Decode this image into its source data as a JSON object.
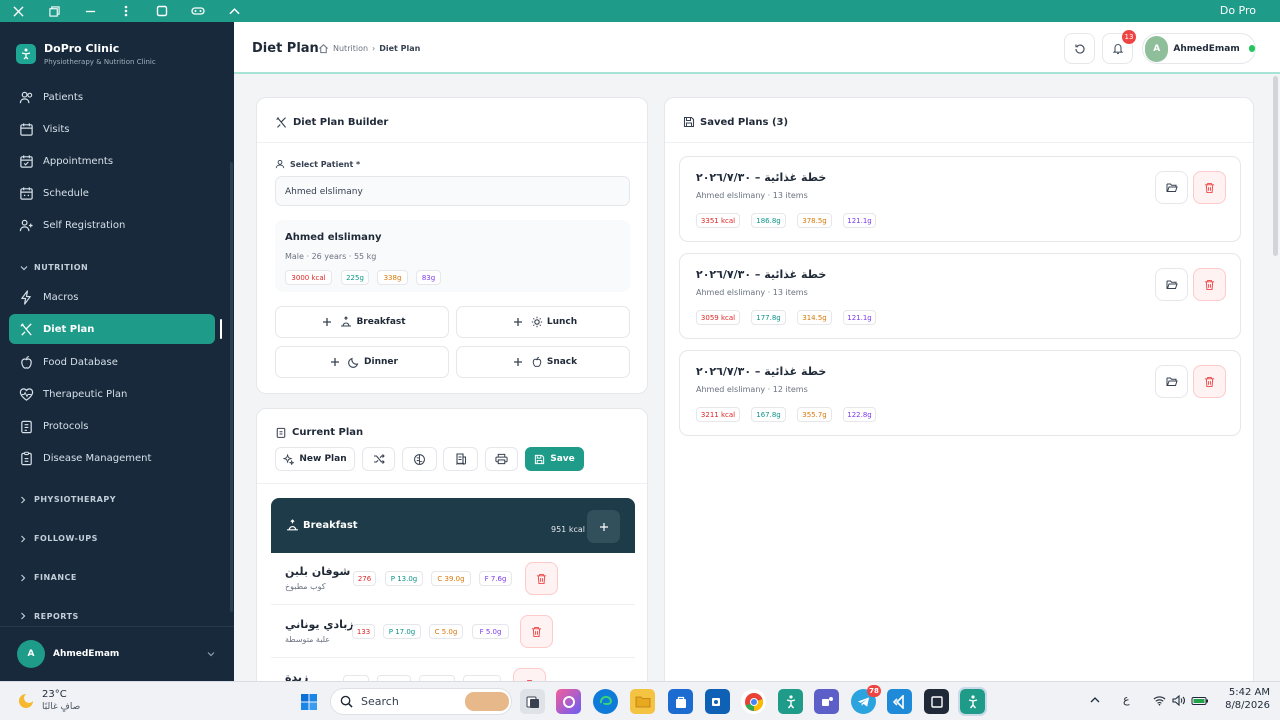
{
  "window": {
    "title": "Do Pro"
  },
  "sidebar": {
    "brand_name": "DoPro Clinic",
    "brand_sub": "Physiotherapy & Nutrition Clinic",
    "items": [
      {
        "label": "Patients"
      },
      {
        "label": "Visits"
      },
      {
        "label": "Appointments"
      },
      {
        "label": "Schedule"
      },
      {
        "label": "Self Registration"
      }
    ],
    "section_nutrition": "NUTRITION",
    "nutrition_items": [
      {
        "label": "Macros"
      },
      {
        "label": "Diet Plan"
      },
      {
        "label": "Food Database"
      },
      {
        "label": "Therapeutic Plan"
      },
      {
        "label": "Protocols"
      },
      {
        "label": "Disease Management"
      }
    ],
    "collapsed_sections": [
      "PHYSIOTHERAPY",
      "FOLLOW-UPS",
      "FINANCE",
      "REPORTS"
    ],
    "user_initial": "A",
    "user_name": "AhmedEmam"
  },
  "header": {
    "title": "Diet Plan",
    "breadcrumb": [
      "Nutrition",
      "Diet Plan"
    ],
    "notification_count": "13",
    "user_initial": "A",
    "user_name": "AhmedEmam"
  },
  "builder": {
    "title": "Diet Plan Builder",
    "select_label": "Select Patient *",
    "patient_value": "Ahmed elslimany",
    "patient_name": "Ahmed elslimany",
    "patient_meta": "Male · 26 years · 55 kg",
    "targets": {
      "kcal": "3000 kcal",
      "protein": "225g",
      "carbs": "338g",
      "fat": "83g"
    },
    "meals": {
      "breakfast": "Breakfast",
      "lunch": "Lunch",
      "dinner": "Dinner",
      "snack": "Snack"
    }
  },
  "current_plan": {
    "title": "Current Plan",
    "new_plan": "New Plan",
    "save": "Save",
    "meal_name": "Breakfast",
    "meal_kcal": "951 kcal",
    "foods": [
      {
        "name": "شوفان بلبن",
        "portion": "كوب مطبوخ",
        "kcal": "276",
        "p": "P 13.0g",
        "c": "C 39.0g",
        "f": "F 7.6g"
      },
      {
        "name": "زبادي يوناني",
        "portion": "علبة متوسطة",
        "kcal": "133",
        "p": "P 17.0g",
        "c": "C 5.0g",
        "f": "F 5.0g"
      },
      {
        "name": "زبدة"
      }
    ]
  },
  "saved": {
    "title": "Saved Plans (3)",
    "plans": [
      {
        "title": "خطة غذائية – ٢٠٢٦/٧/٣٠",
        "sub": "Ahmed elslimany · 13 items",
        "kcal": "3351 kcal",
        "p": "186.8g",
        "c": "378.5g",
        "f": "121.1g"
      },
      {
        "title": "خطة غذائية – ٢٠٢٦/٧/٣٠",
        "sub": "Ahmed elslimany · 13 items",
        "kcal": "3059 kcal",
        "p": "177.8g",
        "c": "314.5g",
        "f": "121.1g"
      },
      {
        "title": "خطة غذائية – ٢٠٢٦/٧/٣٠",
        "sub": "Ahmed elslimany · 12 items",
        "kcal": "3211 kcal",
        "p": "167.8g",
        "c": "355.7g",
        "f": "122.8g"
      }
    ]
  },
  "colors": {
    "accent": "#1f9b8a",
    "sidebar": "#17293a",
    "kcal": "#dc2626",
    "protein": "#0d9488",
    "carbs": "#d97706",
    "fat": "#7c3aed"
  },
  "taskbar": {
    "temp": "23°C",
    "weather": "صافٍ غالبًا",
    "search": "Search",
    "lang": "ع",
    "time": "5:42 AM",
    "date": "8/8/2026",
    "telegram_badge": "78"
  }
}
